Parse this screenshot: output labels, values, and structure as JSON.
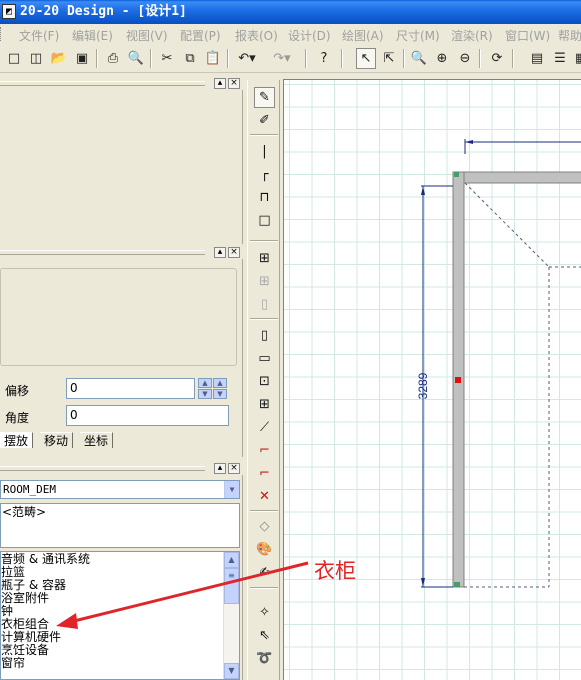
{
  "window": {
    "title": "20-20 Design - [设计1]"
  },
  "menu": [
    "文件(F)",
    "编辑(E)",
    "视图(V)",
    "配置(P)",
    "报表(O)",
    "设计(D)",
    "绘图(A)",
    "尺寸(M)",
    "渲染(R)",
    "窗口(W)",
    "帮助"
  ],
  "properties_panel": {
    "offset_label": "偏移",
    "offset_value": "0",
    "angle_label": "角度",
    "angle_value": "0",
    "tabs": [
      "摆放",
      "移动",
      "坐标"
    ]
  },
  "catalog": {
    "selected": "ROOM_DEM",
    "scope_text": "<范畴>",
    "items": [
      "音频 & 通讯系统",
      "拉篮",
      "瓶子 & 容器",
      "浴室附件",
      "钟",
      "衣柜组合",
      "计算机硬件",
      "烹饪设备",
      "窗帘"
    ]
  },
  "drawing": {
    "dimension": "3289"
  },
  "annotation": {
    "text": "衣柜",
    "color": "#e0252a"
  }
}
